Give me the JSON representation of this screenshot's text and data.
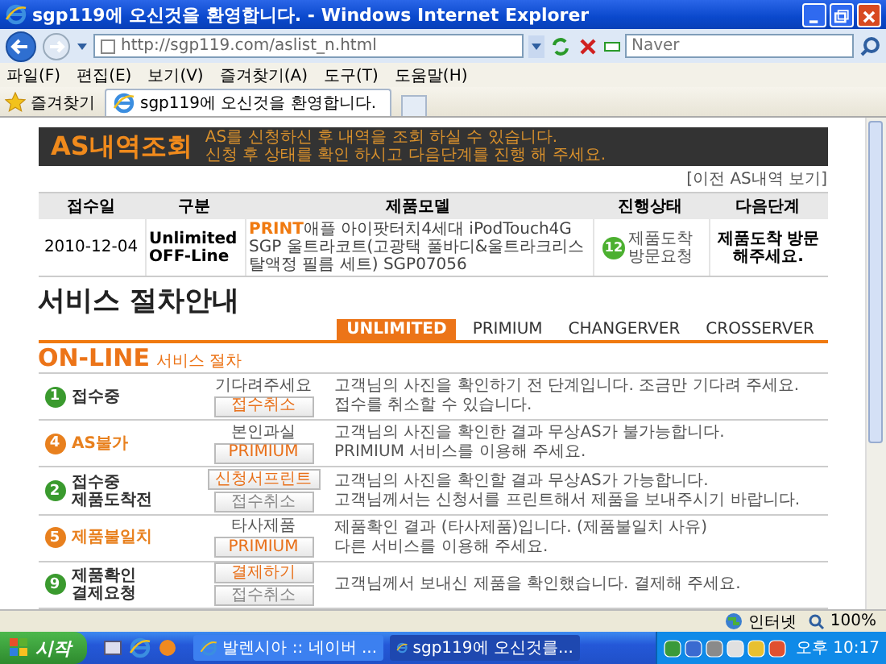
{
  "window": {
    "title": "sgp119에 오신것을 환영합니다. - Windows Internet Explorer"
  },
  "address_bar": {
    "url": "http://sgp119.com/aslist_n.html"
  },
  "search": {
    "placeholder": "Naver"
  },
  "menu": [
    "파일(F)",
    "편집(E)",
    "보기(V)",
    "즐겨찾기(A)",
    "도구(T)",
    "도움말(H)"
  ],
  "favorites_button": "즐겨찾기",
  "tabs": [
    {
      "label": "sgp119에 오신것을 환영합니다.",
      "selected": true
    }
  ],
  "as_lookup": {
    "title": "AS내역조회",
    "notes": [
      "AS를 신청하신 후 내역을 조회 하실 수 있습니다.",
      "신청 후 상태를 확인 하시고 다음단계를 진행 해 주세요."
    ],
    "history_link": "[이전 AS내역 보기]",
    "table": {
      "columns": [
        "접수일",
        "구분",
        "제품모델",
        "진행상태",
        "다음단계"
      ],
      "rows": [
        {
          "date": "2010-12-04",
          "type": [
            "Unlimited",
            "OFF-Line"
          ],
          "model_badge": "PRINT",
          "model": "애플 아이팟터치4세대 iPodTouch4G SGP 울트라코트(고광택 풀바디&울트라크리스탈액정 필름 세트) SGP07056",
          "status_number": "12",
          "status": "제품도착 방문요청",
          "next_step": "제품도착 방문해주세요."
        }
      ]
    }
  },
  "service_guide": {
    "title": "서비스 절차안내",
    "tabs": [
      {
        "label": "UNLIMITED",
        "selected": true
      },
      {
        "label": "PRIMIUM",
        "selected": false
      },
      {
        "label": "CHANGERVER",
        "selected": false
      },
      {
        "label": "CROSSERVER",
        "selected": false
      }
    ],
    "section_title": "ON-LINE",
    "section_subtitle": "서비스 절차",
    "steps": [
      {
        "number": "1",
        "color": "#3a9a2e",
        "label": [
          "접수중"
        ],
        "note": "기다려주세요",
        "buttons": [
          {
            "label": "접수취소",
            "kind": "primary"
          }
        ],
        "description": [
          "고객님의 사진을 확인하기 전 단계입니다. 조금만 기다려 주세요.",
          "접수를 취소할 수 있습니다."
        ]
      },
      {
        "number": "4",
        "color": "#e8801e",
        "label": [
          "AS불가"
        ],
        "note": "본인과실",
        "buttons": [
          {
            "label": "PRIMIUM",
            "kind": "primary"
          }
        ],
        "description": [
          "고객님의 사진을 확인한 결과 무상AS가 불가능합니다.",
          "PRIMIUM 서비스를 이용해 주세요."
        ]
      },
      {
        "number": "2",
        "color": "#3a9a2e",
        "label": [
          "접수중",
          "제품도착전"
        ],
        "buttons": [
          {
            "label": "신청서프린트",
            "kind": "primary"
          },
          {
            "label": "접수취소",
            "kind": "plain"
          }
        ],
        "description": [
          "고객님의 사진을 확인할 결과 무상AS가 가능합니다.",
          "고객님께서는 신청서를 프린트해서 제품을 보내주시기 바랍니다."
        ]
      },
      {
        "number": "5",
        "color": "#e8801e",
        "label": [
          "제품불일치"
        ],
        "note": "타사제품",
        "buttons": [
          {
            "label": "PRIMIUM",
            "kind": "primary"
          }
        ],
        "description": [
          "제품확인 결과 (타사제품)입니다. (제품불일치 사유)",
          "다른 서비스를 이용해 주세요."
        ]
      },
      {
        "number": "9",
        "color": "#3a9a2e",
        "label": [
          "제품확인",
          "결제요청"
        ],
        "buttons": [
          {
            "label": "결제하기",
            "kind": "primary"
          },
          {
            "label": "접수취소",
            "kind": "plain"
          }
        ],
        "description": [
          "고객님께서 보내신 제품을 확인했습니다. 결제해 주세요."
        ]
      }
    ]
  },
  "status_bar": {
    "zone": "인터넷",
    "zoom": "100%"
  },
  "taskbar": {
    "start": "시작",
    "tasks": [
      {
        "label": "발렌시아 :: 네이버 ...",
        "selected": false
      },
      {
        "label": "sgp119에 오신것를...",
        "selected": true
      }
    ],
    "clock": "오후 10:17"
  }
}
